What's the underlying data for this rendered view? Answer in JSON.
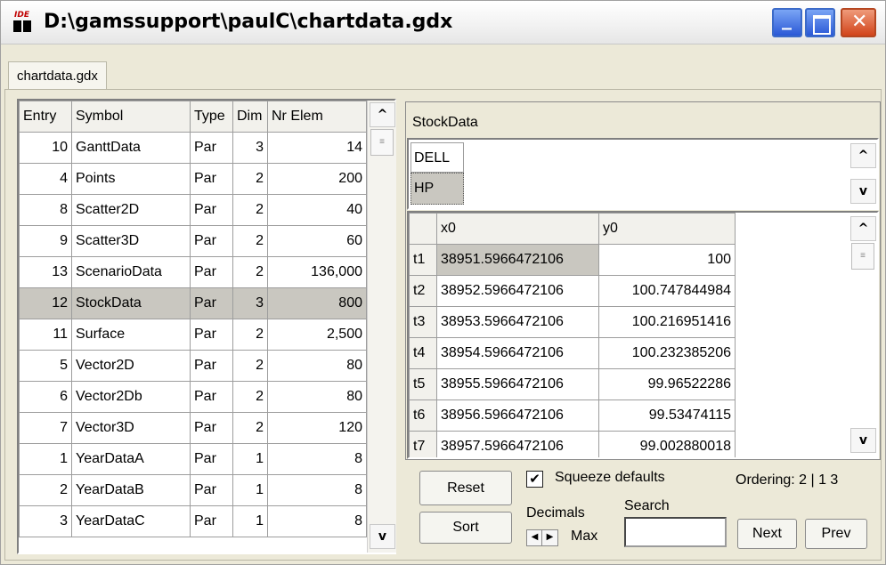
{
  "window": {
    "title": "D:\\gamssupport\\paulC\\chartdata.gdx",
    "icon_text": "IDE"
  },
  "file_tab": "chartdata.gdx",
  "symbol_table": {
    "headers": [
      "Entry",
      "Symbol",
      "Type",
      "Dim",
      "Nr Elem"
    ],
    "rows": [
      {
        "entry": "10",
        "symbol": "GanttData",
        "type": "Par",
        "dim": "3",
        "nrelem": "14"
      },
      {
        "entry": "4",
        "symbol": "Points",
        "type": "Par",
        "dim": "2",
        "nrelem": "200"
      },
      {
        "entry": "8",
        "symbol": "Scatter2D",
        "type": "Par",
        "dim": "2",
        "nrelem": "40"
      },
      {
        "entry": "9",
        "symbol": "Scatter3D",
        "type": "Par",
        "dim": "2",
        "nrelem": "60"
      },
      {
        "entry": "13",
        "symbol": "ScenarioData",
        "type": "Par",
        "dim": "2",
        "nrelem": "136,000"
      },
      {
        "entry": "12",
        "symbol": "StockData",
        "type": "Par",
        "dim": "3",
        "nrelem": "800",
        "selected": true
      },
      {
        "entry": "11",
        "symbol": "Surface",
        "type": "Par",
        "dim": "2",
        "nrelem": "2,500"
      },
      {
        "entry": "5",
        "symbol": "Vector2D",
        "type": "Par",
        "dim": "2",
        "nrelem": "80"
      },
      {
        "entry": "6",
        "symbol": "Vector2Db",
        "type": "Par",
        "dim": "2",
        "nrelem": "80"
      },
      {
        "entry": "7",
        "symbol": "Vector3D",
        "type": "Par",
        "dim": "2",
        "nrelem": "120"
      },
      {
        "entry": "1",
        "symbol": "YearDataA",
        "type": "Par",
        "dim": "1",
        "nrelem": "8"
      },
      {
        "entry": "2",
        "symbol": "YearDataB",
        "type": "Par",
        "dim": "1",
        "nrelem": "8"
      },
      {
        "entry": "3",
        "symbol": "YearDataC",
        "type": "Par",
        "dim": "1",
        "nrelem": "8"
      }
    ]
  },
  "data_view": {
    "symbol_name": "StockData",
    "dim_items": [
      "DELL",
      "HP"
    ],
    "columns": [
      "x0",
      "y0"
    ],
    "rows": [
      {
        "key": "t1",
        "x0": "38951.5966472106",
        "y0": "100"
      },
      {
        "key": "t2",
        "x0": "38952.5966472106",
        "y0": "100.747844984"
      },
      {
        "key": "t3",
        "x0": "38953.5966472106",
        "y0": "100.216951416"
      },
      {
        "key": "t4",
        "x0": "38954.5966472106",
        "y0": "100.232385206"
      },
      {
        "key": "t5",
        "x0": "38955.5966472106",
        "y0": "99.96522286"
      },
      {
        "key": "t6",
        "x0": "38956.5966472106",
        "y0": "99.53474115"
      },
      {
        "key": "t7",
        "x0": "38957.5966472106",
        "y0": "99.002880018"
      }
    ]
  },
  "controls": {
    "reset": "Reset",
    "sort": "Sort",
    "squeeze": "Squeeze defaults",
    "squeeze_checked": true,
    "ordering": "Ordering: 2 | 1 3",
    "decimals": "Decimals",
    "max": "Max",
    "search": "Search",
    "search_value": "",
    "next": "Next",
    "prev": "Prev"
  }
}
